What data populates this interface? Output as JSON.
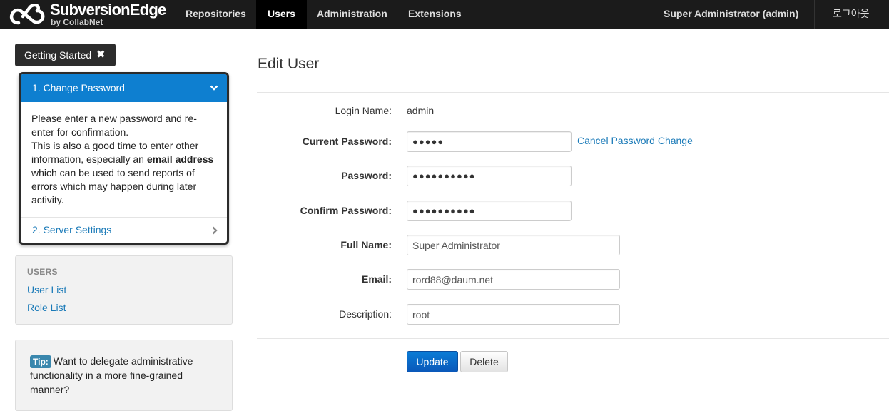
{
  "colors": {
    "navbar": "#1b1b1b",
    "accent": "#0e7fd0",
    "link": "#1a7ab8",
    "primary_button": "#0a6bcc"
  },
  "brand": {
    "title": "SubversionEdge",
    "subtitle": "by CollabNet",
    "logo_icon": "collabnet-logo-icon"
  },
  "nav": {
    "items": [
      {
        "label": "Repositories",
        "active": false
      },
      {
        "label": "Users",
        "active": true
      },
      {
        "label": "Administration",
        "active": false
      },
      {
        "label": "Extensions",
        "active": false
      }
    ],
    "user": "Super Administrator (admin)",
    "logout": "로그아웃"
  },
  "getting_started": {
    "label": "Getting Started",
    "close_icon": "close-icon",
    "step1": {
      "title": "1. Change Password",
      "icon": "chevron-down-icon",
      "body_1": "Please enter a new password and re-enter for confirmation.",
      "body_2": "This is also a good time to enter other information, especially an",
      "body_bold": "email address",
      "body_3": "which can be used to send reports of errors which may happen during later activity."
    },
    "step2": {
      "title": "2. Server Settings",
      "icon": "chevron-right-icon"
    }
  },
  "users_panel": {
    "header": "USERS",
    "links": [
      "User List",
      "Role List"
    ]
  },
  "tip": {
    "badge": "Tip:",
    "text": "Want to delegate administrative functionality in a more fine-grained manner?"
  },
  "form": {
    "title": "Edit User",
    "login_name_label": "Login Name:",
    "login_name_value": "admin",
    "current_password_label": "Current Password:",
    "current_password_value": "●●●●●",
    "cancel_password_change": "Cancel Password Change",
    "password_label": "Password:",
    "password_value": "●●●●●●●●●●",
    "confirm_password_label": "Confirm Password:",
    "confirm_password_value": "●●●●●●●●●●",
    "full_name_label": "Full Name:",
    "full_name_value": "Super Administrator",
    "email_label": "Email:",
    "email_value": "rord88@daum.net",
    "description_label": "Description:",
    "description_value": "root",
    "update_button": "Update",
    "delete_button": "Delete"
  }
}
